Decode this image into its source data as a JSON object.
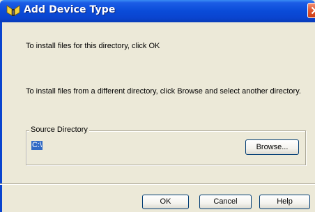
{
  "window": {
    "title": "Add Device Type",
    "title_icon": "device-type-icon",
    "close_icon": "close-icon"
  },
  "messages": {
    "line1": "To install files for this directory, click OK",
    "line2": "To install files from a different directory, click Browse and select another directory."
  },
  "source_directory": {
    "legend": "Source Directory",
    "path": "C:\\",
    "browse_label": "Browse..."
  },
  "buttons": {
    "ok": "OK",
    "cancel": "Cancel",
    "help": "Help"
  },
  "colors": {
    "titlebar": "#0a4bd8",
    "dialog_bg": "#ece9d8",
    "selection": "#316ac5",
    "close": "#e35a32"
  }
}
